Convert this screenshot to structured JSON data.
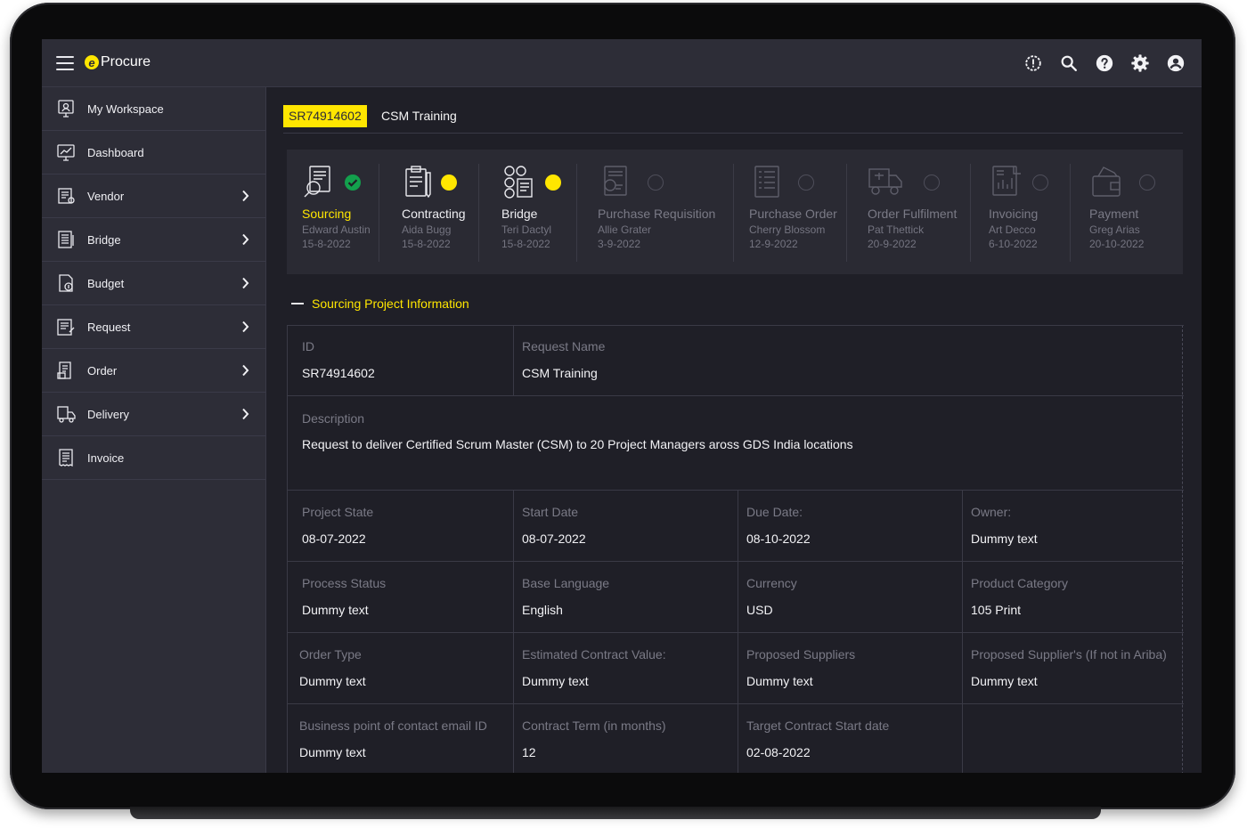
{
  "app": {
    "logo_glyph": "e",
    "name": "Procure"
  },
  "topbar": {
    "icons": [
      "alert-circle-icon",
      "search-icon",
      "help-icon",
      "settings-icon",
      "user-icon"
    ]
  },
  "sidebar": {
    "items": [
      {
        "label": "My Workspace",
        "icon": "workspace-icon",
        "expandable": false
      },
      {
        "label": "Dashboard",
        "icon": "dashboard-icon",
        "expandable": false
      },
      {
        "label": "Vendor",
        "icon": "vendor-icon",
        "expandable": true
      },
      {
        "label": "Bridge",
        "icon": "bridge-icon",
        "expandable": true
      },
      {
        "label": "Budget",
        "icon": "budget-icon",
        "expandable": true
      },
      {
        "label": "Request",
        "icon": "request-icon",
        "expandable": true
      },
      {
        "label": "Order",
        "icon": "order-icon",
        "expandable": true
      },
      {
        "label": "Delivery",
        "icon": "delivery-icon",
        "expandable": true
      },
      {
        "label": "Invoice",
        "icon": "invoice-icon",
        "expandable": false
      }
    ]
  },
  "header": {
    "id_tag": "SR74914602",
    "title": "CSM Training"
  },
  "colors": {
    "accent": "#ffe600",
    "success": "#13a04d",
    "pending": "#ffe600",
    "inactive": "#6a6a76"
  },
  "workflow": {
    "steps": [
      {
        "name": "Sourcing",
        "person": "Edward Austin",
        "date": "15-8-2022",
        "status": "done",
        "icon": "sourcing-icon"
      },
      {
        "name": "Contracting",
        "person": "Aida Bugg",
        "date": "15-8-2022",
        "status": "in-progress",
        "icon": "contracting-icon"
      },
      {
        "name": "Bridge",
        "person": "Teri Dactyl",
        "date": "15-8-2022",
        "status": "in-progress",
        "icon": "bridge-step-icon"
      },
      {
        "name": "Purchase Requisition",
        "person": "Allie Grater",
        "date": "3-9-2022",
        "status": "pending",
        "icon": "requisition-icon"
      },
      {
        "name": "Purchase Order",
        "person": "Cherry Blossom",
        "date": "12-9-2022",
        "status": "pending",
        "icon": "purchase-order-icon"
      },
      {
        "name": "Order Fulfilment",
        "person": "Pat Thettick",
        "date": "20-9-2022",
        "status": "pending",
        "icon": "delivery-truck-icon"
      },
      {
        "name": "Invoicing",
        "person": "Art Decco",
        "date": "6-10-2022",
        "status": "pending",
        "icon": "invoicing-icon"
      },
      {
        "name": "Payment",
        "person": "Greg Arias",
        "date": "20-10-2022",
        "status": "pending",
        "icon": "payment-icon"
      }
    ]
  },
  "section": {
    "title": "Sourcing Project Information"
  },
  "fields": {
    "id": {
      "label": "ID",
      "value": "SR74914602"
    },
    "request_name": {
      "label": "Request Name",
      "value": "CSM Training"
    },
    "description": {
      "label": "Description",
      "value": "Request to deliver Certified Scrum Master (CSM) to 20 Project Managers aross GDS India locations"
    },
    "project_state": {
      "label": "Project State",
      "value": "08-07-2022"
    },
    "start_date": {
      "label": "Start Date",
      "value": "08-07-2022"
    },
    "due_date": {
      "label": "Due Date:",
      "value": "08-10-2022"
    },
    "owner": {
      "label": "Owner:",
      "value": "Dummy text"
    },
    "process_status": {
      "label": "Process Status",
      "value": "Dummy text"
    },
    "base_language": {
      "label": "Base Language",
      "value": "English"
    },
    "currency": {
      "label": "Currency",
      "value": "USD"
    },
    "product_category": {
      "label": "Product Category",
      "value": "105 Print"
    },
    "order_type": {
      "label": "Order Type",
      "value": "Dummy text"
    },
    "est_contract_value": {
      "label": "Estimated Contract Value:",
      "value": "Dummy text"
    },
    "proposed_suppliers": {
      "label": "Proposed Suppliers",
      "value": "Dummy text"
    },
    "proposed_supplier_not_ariba": {
      "label": "Proposed Supplier's (If not in Ariba)",
      "value": "Dummy text"
    },
    "contact_email": {
      "label": "Business point of contact email ID",
      "value": "Dummy text"
    },
    "contract_term": {
      "label": "Contract Term (in months)",
      "value": "12"
    },
    "target_start": {
      "label": "Target Contract Start date",
      "value": "02-08-2022"
    }
  }
}
